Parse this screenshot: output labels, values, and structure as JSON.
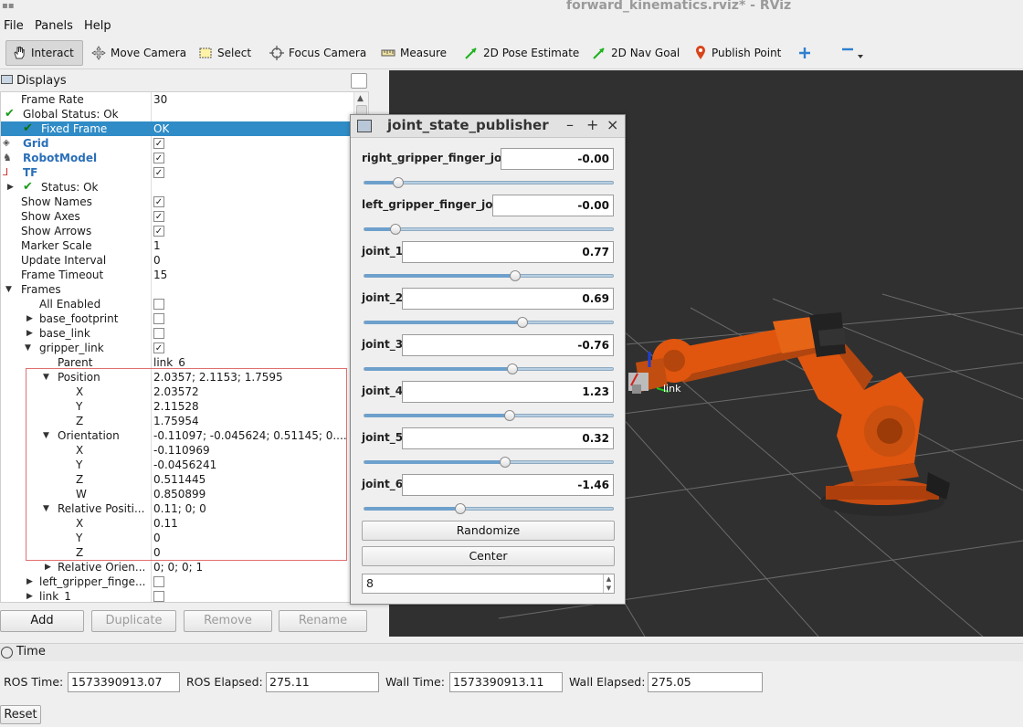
{
  "window": {
    "title": "forward_kinematics.rviz* - RViz"
  },
  "menu": [
    "File",
    "Panels",
    "Help"
  ],
  "toolbar": {
    "tools": [
      {
        "label": "Interact",
        "icon": "hand-icon"
      },
      {
        "label": "Move Camera",
        "icon": "move-camera-icon"
      },
      {
        "label": "Select",
        "icon": "select-icon"
      },
      {
        "label": "Focus Camera",
        "icon": "focus-camera-icon"
      },
      {
        "label": "Measure",
        "icon": "measure-icon"
      },
      {
        "label": "2D Pose Estimate",
        "icon": "pose-estimate-icon"
      },
      {
        "label": "2D Nav Goal",
        "icon": "nav-goal-icon"
      },
      {
        "label": "Publish Point",
        "icon": "publish-point-icon"
      }
    ],
    "extra_icons": [
      "add-tool-icon",
      "remove-tool-icon"
    ]
  },
  "displays": {
    "title": "Displays",
    "rows": [
      {
        "name": "Frame Rate",
        "value": "30"
      },
      {
        "name": "Global Status: Ok",
        "value": ""
      },
      {
        "name": "Fixed Frame",
        "value": "OK"
      },
      {
        "name": "Grid",
        "value": ""
      },
      {
        "name": "RobotModel",
        "value": ""
      },
      {
        "name": "TF",
        "value": ""
      },
      {
        "name": "Status: Ok",
        "value": ""
      },
      {
        "name": "Show Names",
        "value": ""
      },
      {
        "name": "Show Axes",
        "value": ""
      },
      {
        "name": "Show Arrows",
        "value": ""
      },
      {
        "name": "Marker Scale",
        "value": "1"
      },
      {
        "name": "Update Interval",
        "value": "0"
      },
      {
        "name": "Frame Timeout",
        "value": "15"
      },
      {
        "name": "Frames",
        "value": ""
      },
      {
        "name": "All Enabled",
        "value": ""
      },
      {
        "name": "base_footprint",
        "value": ""
      },
      {
        "name": "base_link",
        "value": ""
      },
      {
        "name": "gripper_link",
        "value": ""
      },
      {
        "name": "Parent",
        "value": "link_6"
      },
      {
        "name": "Position",
        "value": "2.0357; 2.1153; 1.7595"
      },
      {
        "name": "X",
        "value": "2.03572"
      },
      {
        "name": "Y",
        "value": "2.11528"
      },
      {
        "name": "Z",
        "value": "1.75954"
      },
      {
        "name": "Orientation",
        "value": "-0.11097; -0.045624; 0.51145; 0...."
      },
      {
        "name": "X",
        "value": "-0.110969"
      },
      {
        "name": "Y",
        "value": "-0.0456241"
      },
      {
        "name": "Z",
        "value": "0.511445"
      },
      {
        "name": "W",
        "value": "0.850899"
      },
      {
        "name": "Relative Positi...",
        "value": "0.11; 0; 0"
      },
      {
        "name": "X",
        "value": "0.11"
      },
      {
        "name": "Y",
        "value": "0"
      },
      {
        "name": "Z",
        "value": "0"
      },
      {
        "name": "Relative Orien...",
        "value": "0; 0; 0; 1"
      },
      {
        "name": "left_gripper_finge...",
        "value": ""
      },
      {
        "name": "link_1",
        "value": ""
      }
    ],
    "buttons": {
      "add": "Add",
      "duplicate": "Duplicate",
      "remove": "Remove",
      "rename": "Rename"
    }
  },
  "joint_state_publisher": {
    "title": "joint_state_publisher",
    "joints": [
      {
        "name": "right_gripper_finger_joint",
        "value": "-0.00",
        "position": 0.14
      },
      {
        "name": "left_gripper_finger_joint",
        "value": "-0.00",
        "position": 0.13
      },
      {
        "name": "joint_1",
        "value": "0.77",
        "position": 0.61
      },
      {
        "name": "joint_2",
        "value": "0.69",
        "position": 0.64
      },
      {
        "name": "joint_3",
        "value": "-0.76",
        "position": 0.6
      },
      {
        "name": "joint_4",
        "value": "1.23",
        "position": 0.59
      },
      {
        "name": "joint_5",
        "value": "0.32",
        "position": 0.57
      },
      {
        "name": "joint_6",
        "value": "-1.46",
        "position": 0.39
      }
    ],
    "randomize": "Randomize",
    "center": "Center",
    "spin_value": "8"
  },
  "view3d": {
    "frame_label": "link"
  },
  "time": {
    "title": "Time",
    "ros_time_label": "ROS Time:",
    "ros_time": "1573390913.07",
    "ros_elapsed_label": "ROS Elapsed:",
    "ros_elapsed": "275.11",
    "wall_time_label": "Wall Time:",
    "wall_time": "1573390913.11",
    "wall_elapsed_label": "Wall Elapsed:",
    "wall_elapsed": "275.05",
    "reset": "Reset"
  },
  "colors": {
    "selection": "#308cc6",
    "robot": "#e0560f",
    "background3d": "#303030"
  }
}
